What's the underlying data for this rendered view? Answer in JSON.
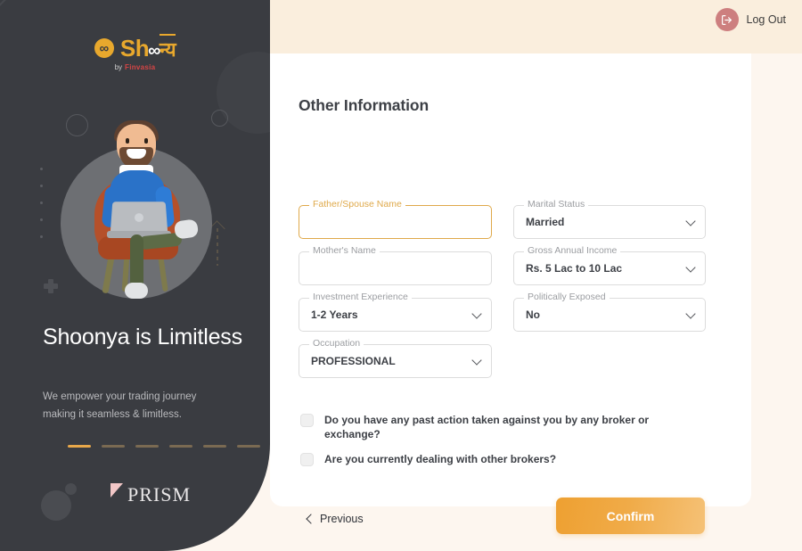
{
  "brand": {
    "logo_mark": "infinity-icon",
    "logo_text_lead": "Sh",
    "logo_text_infinity": "∞",
    "logo_text_devanagari": "न्य",
    "logo_by": "by",
    "logo_company": "Finvasia"
  },
  "promo": {
    "headline": "Shoonya is Limitless",
    "subline": "We empower your trading journey making it seamless & limitless.",
    "carousel_total": 6,
    "carousel_active": 1,
    "footer_logo": "PRISM"
  },
  "topbar": {
    "logout_label": "Log Out",
    "logout_icon": "logout-icon",
    "logout_color": "#cd7f7f"
  },
  "main": {
    "title": "Other Information",
    "fields": [
      {
        "id": "father",
        "label": "Father/Spouse Name",
        "value": "",
        "type": "text",
        "focused": true
      },
      {
        "id": "mother",
        "label": "Mother's Name",
        "value": "",
        "type": "text",
        "focused": false
      },
      {
        "id": "invexp",
        "label": "Investment Experience",
        "value": "1-2 Years",
        "type": "select",
        "focused": false
      },
      {
        "id": "occ",
        "label": "Occupation",
        "value": "PROFESSIONAL",
        "type": "select",
        "focused": false
      },
      {
        "id": "marital",
        "label": "Marital Status",
        "value": "Married",
        "type": "select",
        "focused": false
      },
      {
        "id": "income",
        "label": "Gross Annual Income",
        "value": "Rs. 5 Lac to 10 Lac",
        "type": "select",
        "focused": false
      },
      {
        "id": "pep",
        "label": "Politically Exposed",
        "value": "No",
        "type": "select",
        "focused": false
      }
    ],
    "checkboxes": [
      {
        "label": "Do you have any past action taken against you by any broker or exchange?",
        "checked": false
      },
      {
        "label": "Are you currently dealing with other brokers?",
        "checked": false
      }
    ],
    "previous_label": "Previous",
    "confirm_label": "Confirm"
  },
  "colors": {
    "accent_orange": "#eea031",
    "panel_dark": "#3a3c41",
    "cream": "#faeedd",
    "focus_border": "#dfa94a"
  }
}
